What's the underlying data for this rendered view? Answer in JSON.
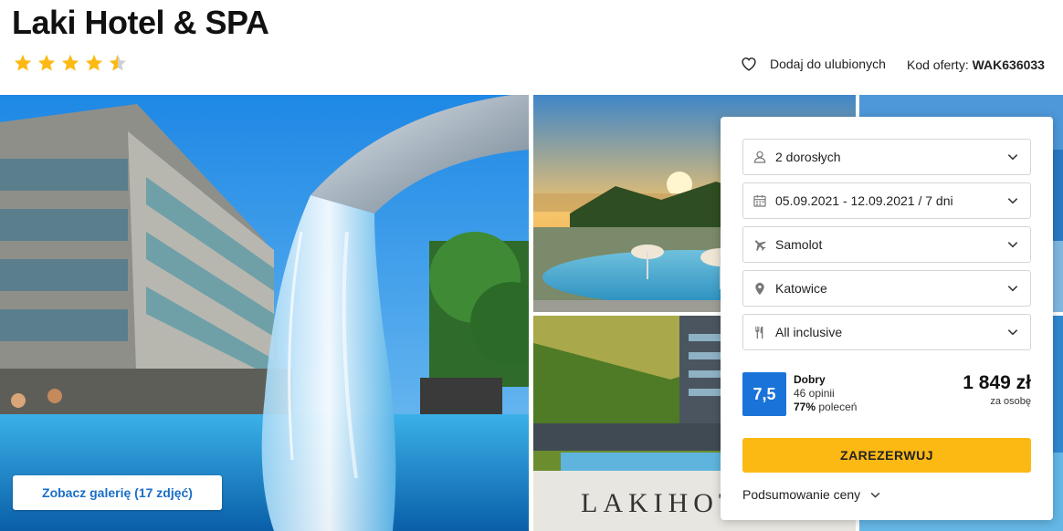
{
  "hotel": {
    "title": "Laki Hotel & SPA",
    "stars": 4.5
  },
  "header": {
    "favorite_label": "Dodaj do ulubionych",
    "offer_code_label": "Kod oferty:",
    "offer_code_value": "WAK636033"
  },
  "gallery": {
    "button_label": "Zobacz galerię (17 zdjęć)",
    "photo_text": "LAKIHOTEL&"
  },
  "booking": {
    "fields": [
      {
        "icon": "person-icon",
        "label": "2 dorosłych"
      },
      {
        "icon": "calendar-icon",
        "label": "05.09.2021 - 12.09.2021 / 7 dni"
      },
      {
        "icon": "plane-icon",
        "label": "Samolot"
      },
      {
        "icon": "location-pin-icon",
        "label": "Katowice"
      },
      {
        "icon": "cutlery-icon",
        "label": "All inclusive"
      }
    ],
    "rating": {
      "score": "7,5",
      "label": "Dobry",
      "reviews": "46 opinii",
      "recommend_pct": "77%",
      "recommend_label": "poleceń"
    },
    "price": {
      "amount": "1 849 zł",
      "per": "za osobę"
    },
    "book_label": "ZAREZERWUJ",
    "summary_label": "Podsumowanie ceny"
  },
  "colors": {
    "accent_blue": "#1a73d9",
    "star_yellow": "#fdb913",
    "button_yellow": "#fdb913",
    "link_blue": "#1a6fc7"
  }
}
